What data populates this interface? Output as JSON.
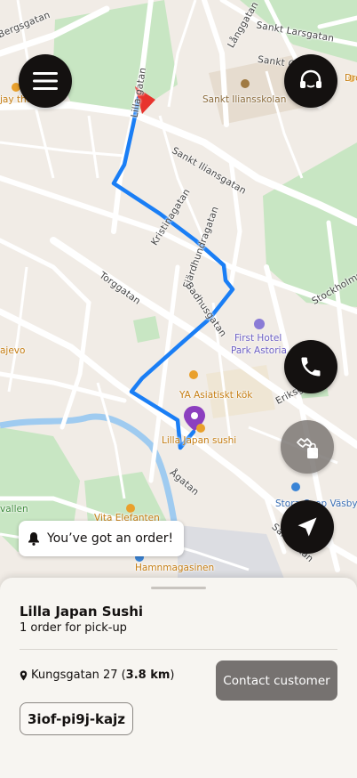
{
  "map": {
    "streets": {
      "bergsgatan": "Bergsgatan",
      "sankt_larsgatan": "Sankt Larsgatan",
      "sankt_olof": "Sankt Ol",
      "langgatan": "Långgatan",
      "lilla_gatan": "Lilla gatan",
      "sankt_iliansgatan": "Sankt Iliansgatan",
      "kristinagatan": "Kristinagatan",
      "fjardhundragatan": "Fjärdhundragatan",
      "torggatan": "Torggatan",
      "badhusgatan": "Badhusgatan",
      "stockholmsvagen": "Stockholms",
      "erikgatan": "Eriksgatan",
      "agatan": "Ågatan",
      "sandgatan": "Sandgatan"
    },
    "pois": {
      "sankt_iliansskolan": "Sankt Iliansskolan",
      "jay_the": "jay the",
      "dro": "Dro",
      "first_hotel": "First Hotel",
      "park_astoria": "Park Astoria",
      "ya_asiatiskt": "YA Asiatiskt kök",
      "lilla_japan_sushi": "Lilla Japan sushi",
      "ajevo": "ajevo",
      "vallen": "vallen",
      "vita_elefanten": "Vita Elefanten",
      "hamnmagasinen": "Hamnmagasinen",
      "stora_coop": "Stora Coop Väsby"
    },
    "route_color": "#1a7ef5",
    "destination_pin_color": "#8c3fbf",
    "heading_arrow_color": "#e8332d"
  },
  "buttons": {
    "menu_icon": "hamburger-menu-icon",
    "support_icon": "headset-icon",
    "call_icon": "phone-icon",
    "handoff_icon": "hand-bag-icon",
    "navigate_icon": "navigation-arrow-icon"
  },
  "notification": {
    "text": "You’ve got an order!",
    "icon": "bell-icon"
  },
  "order_sheet": {
    "venue_name": "Lilla Japan Sushi",
    "order_summary": "1 order for pick-up",
    "address": "Kungsgatan 27",
    "distance": "3.8 km",
    "contact_label": "Contact customer",
    "pickup_code": "3iof-pi9j-kajz"
  }
}
